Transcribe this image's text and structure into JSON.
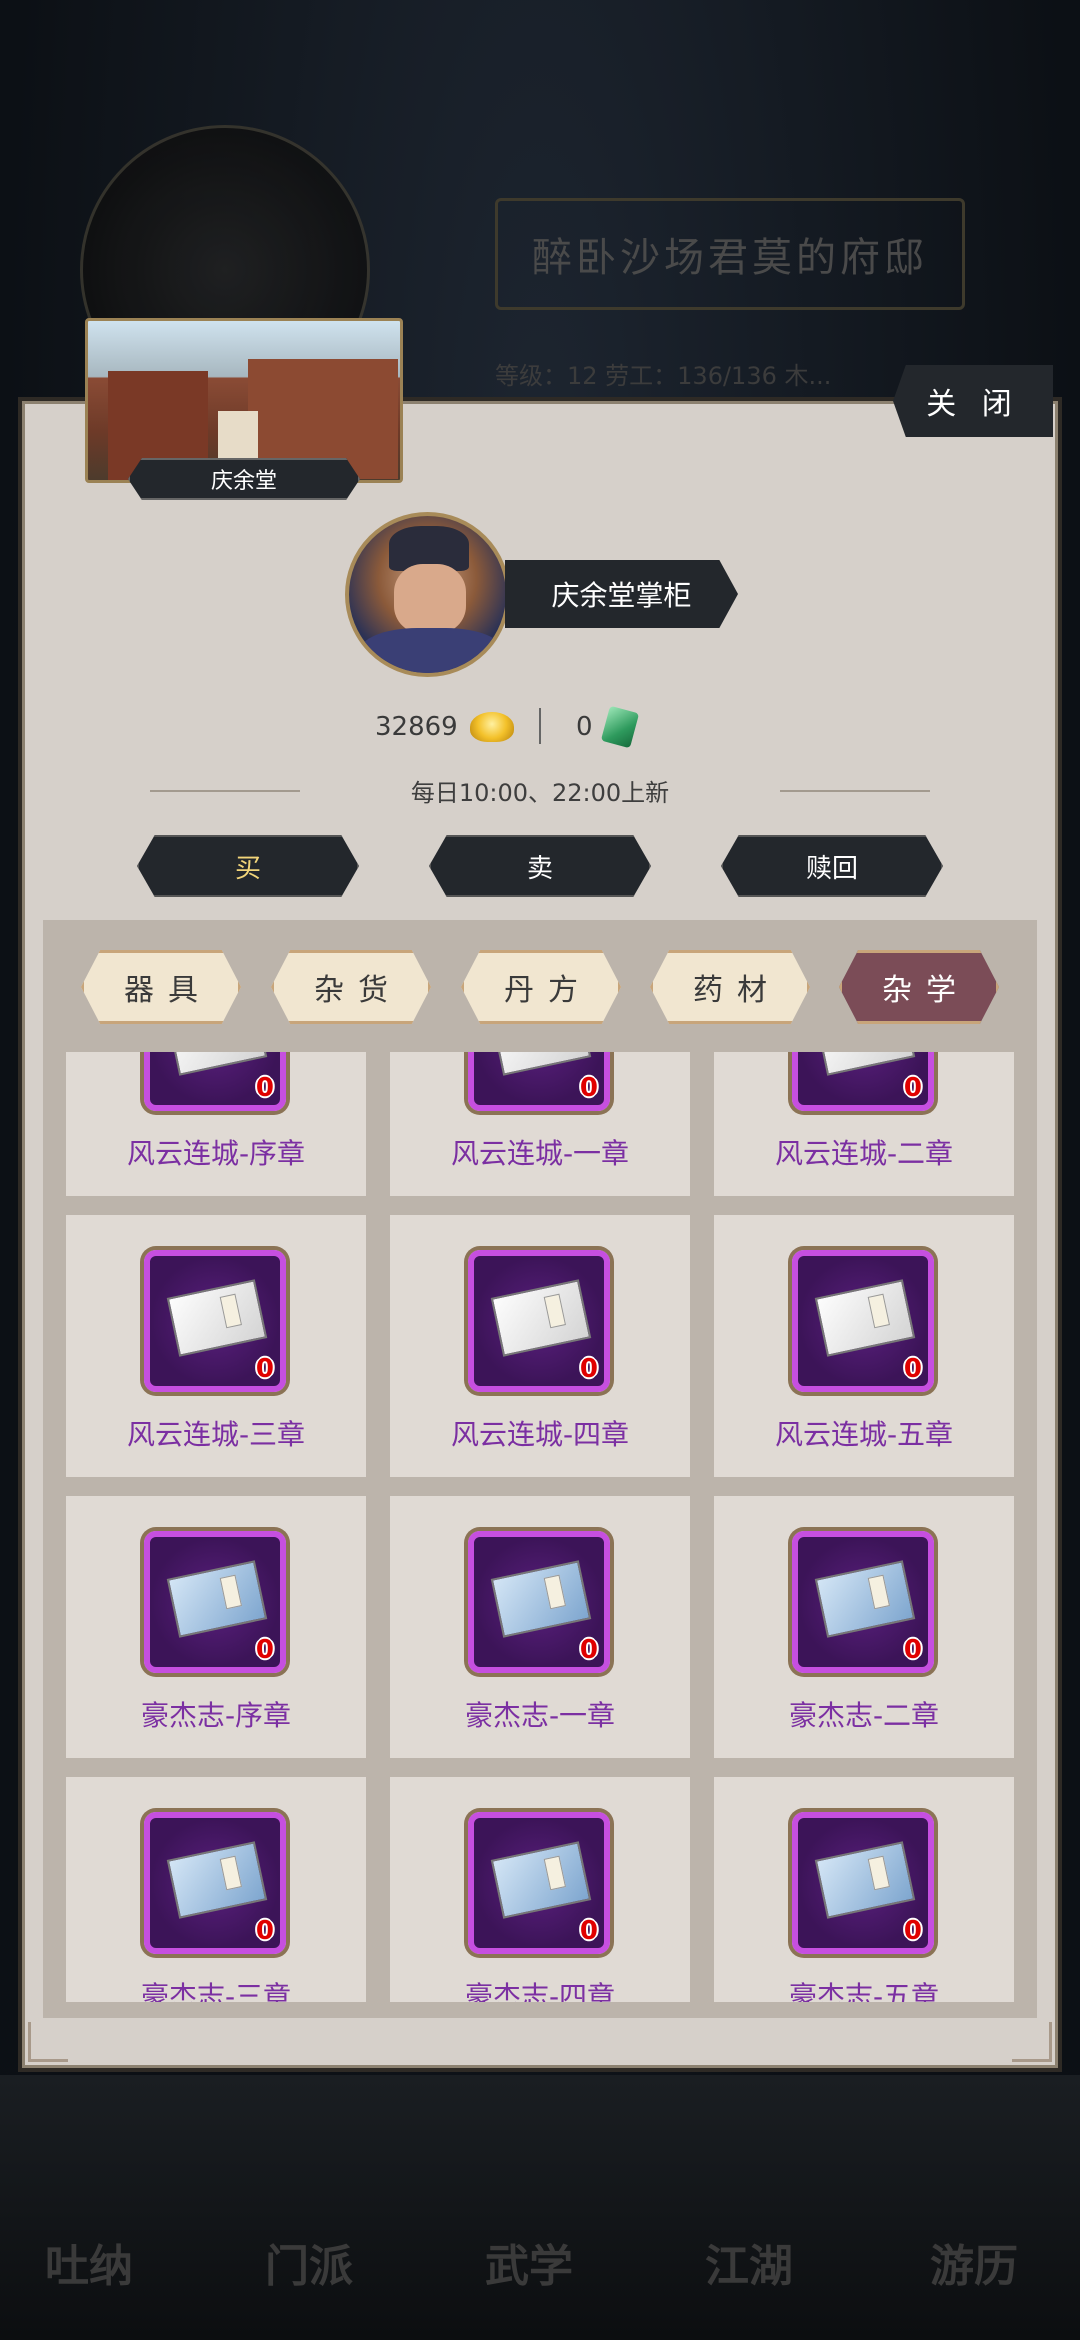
{
  "background": {
    "residence_title": "醉卧沙场君莫的府邸",
    "stats_text": "等级：12   劳工：136/136   木..."
  },
  "nav": [
    "吐纳",
    "门派",
    "武学",
    "江湖",
    "游历"
  ],
  "shop": {
    "name": "庆余堂",
    "close_label": "关 闭",
    "npc_name": "庆余堂掌柜",
    "gold": "32869",
    "jade": "0",
    "refresh_note": "每日10:00、22:00上新",
    "tabs": [
      {
        "label": "买",
        "active": true
      },
      {
        "label": "卖",
        "active": false
      },
      {
        "label": "赎回",
        "active": false
      }
    ],
    "categories": [
      {
        "label": "器具",
        "active": false
      },
      {
        "label": "杂货",
        "active": false
      },
      {
        "label": "丹方",
        "active": false
      },
      {
        "label": "药材",
        "active": false
      },
      {
        "label": "杂学",
        "active": true
      }
    ],
    "items": [
      {
        "name": "风云连城-序章",
        "count": "0",
        "icon": "white-book-icon"
      },
      {
        "name": "风云连城-一章",
        "count": "0",
        "icon": "white-book-icon"
      },
      {
        "name": "风云连城-二章",
        "count": "0",
        "icon": "white-book-icon"
      },
      {
        "name": "风云连城-三章",
        "count": "0",
        "icon": "white-book-icon"
      },
      {
        "name": "风云连城-四章",
        "count": "0",
        "icon": "white-book-icon"
      },
      {
        "name": "风云连城-五章",
        "count": "0",
        "icon": "white-book-icon"
      },
      {
        "name": "豪杰志-序章",
        "count": "0",
        "icon": "blue-book-icon"
      },
      {
        "name": "豪杰志-一章",
        "count": "0",
        "icon": "blue-book-icon"
      },
      {
        "name": "豪杰志-二章",
        "count": "0",
        "icon": "blue-book-icon"
      },
      {
        "name": "豪杰志-三章",
        "count": "0",
        "icon": "blue-book-icon"
      },
      {
        "name": "豪杰志-四章",
        "count": "0",
        "icon": "blue-book-icon"
      },
      {
        "name": "豪杰志-五章",
        "count": "0",
        "icon": "blue-book-icon"
      }
    ]
  },
  "colors": {
    "item_name": "#7b2fa2",
    "item_frame": "#c64fe0",
    "active_category": "#7b4c57",
    "count": "#e00000"
  }
}
